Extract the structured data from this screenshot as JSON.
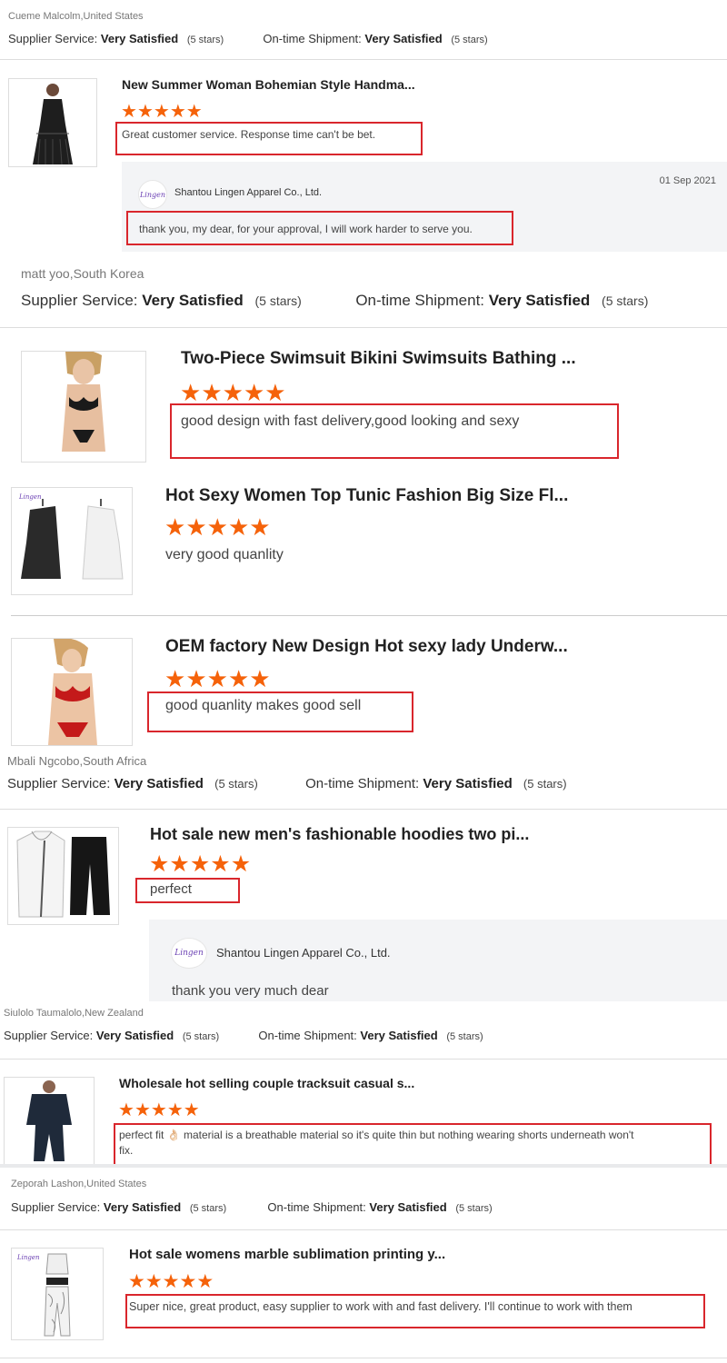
{
  "labels": {
    "supplier_service": "Supplier Service:",
    "ontime_shipment": "On-time Shipment:",
    "very_satisfied": "Very Satisfied",
    "five_stars": "(5 stars)",
    "star": "★"
  },
  "reviews": [
    {
      "reviewer": "Cueme Malcolm,United States",
      "items": [
        {
          "title": "New Summer Woman Bohemian Style Handma...",
          "rating": 5,
          "comment": "Great customer service. Response time can't be bet.",
          "reply": {
            "logo": "lingen",
            "company": "Shantou Lingen Apparel Co., Ltd.",
            "date": "01 Sep 2021",
            "text": "thank you, my dear, for your approval, I will work harder to serve you."
          }
        }
      ]
    },
    {
      "reviewer": "matt yoo,South Korea",
      "items": [
        {
          "title": "Two-Piece Swimsuit Bikini Swimsuits Bathing ...",
          "rating": 5,
          "comment": "good design with fast delivery,good looking and sexy"
        },
        {
          "title": "Hot Sexy Women Top Tunic Fashion Big Size Fl...",
          "rating": 5,
          "comment": "very good quanlity",
          "thumb_logo": "lingen"
        },
        {
          "title": "OEM factory New Design Hot sexy lady Underw...",
          "rating": 5,
          "comment": "good quanlity makes good sell"
        }
      ]
    },
    {
      "reviewer": "Mbali Ngcobo,South Africa",
      "items": [
        {
          "title": "Hot sale new men's fashionable hoodies two pi...",
          "rating": 5,
          "comment": "perfect",
          "reply": {
            "logo": "lingen",
            "company": "Shantou Lingen Apparel Co., Ltd.",
            "text": "thank you very much dear"
          }
        }
      ]
    },
    {
      "reviewer": "Siulolo Taumalolo,New Zealand",
      "items": [
        {
          "title": "Wholesale hot selling couple tracksuit casual s...",
          "rating": 5,
          "comment_line1": "perfect fit 👌🏻 material is a breathable material so it's quite thin but nothing wearing shorts underneath won't",
          "comment_line2": "fix."
        }
      ]
    },
    {
      "reviewer": "Zeporah Lashon,United States",
      "items": [
        {
          "title": "Hot sale womens marble sublimation printing y...",
          "rating": 5,
          "comment": "Super nice,  great product, easy supplier to work with and fast delivery. I'll continue to work with them",
          "thumb_logo": "lingen"
        }
      ]
    }
  ],
  "colors": {
    "star": "#f5620a",
    "highlight_box": "#d9262c",
    "reply_bg": "#f3f4f6"
  }
}
